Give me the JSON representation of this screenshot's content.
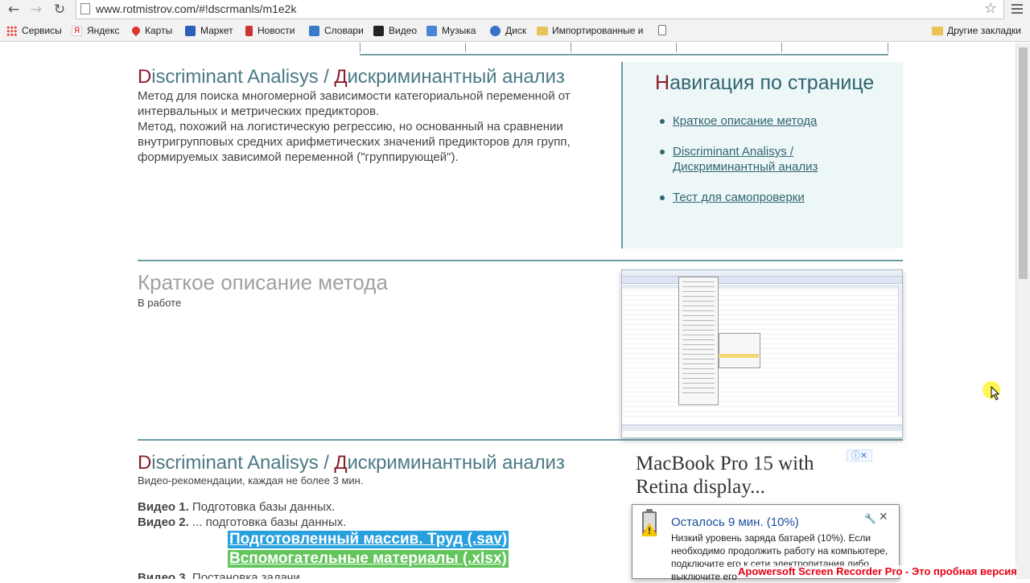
{
  "browser": {
    "url": "www.rotmistrov.com/#!dscrmanls/m1e2k",
    "bookmarks": [
      {
        "label": "Сервисы",
        "icon": "apps-icon"
      },
      {
        "label": "Яндекс",
        "icon": "yandex-icon"
      },
      {
        "label": "Карты",
        "icon": "maps-pin-icon"
      },
      {
        "label": "Маркет",
        "icon": "cart-icon"
      },
      {
        "label": "Новости",
        "icon": "news-icon"
      },
      {
        "label": "Словари",
        "icon": "dictionary-icon"
      },
      {
        "label": "Видео",
        "icon": "video-icon"
      },
      {
        "label": "Музыка",
        "icon": "music-icon"
      },
      {
        "label": "Диск",
        "icon": "disk-icon"
      },
      {
        "label": "Импортированные и",
        "icon": "folder-icon"
      }
    ],
    "other_bookmarks": "Другие закладки"
  },
  "section1": {
    "title_first": "D",
    "title_rest": "iscriminant Analisys / ",
    "title_first2": "Д",
    "title_rest2": "искриминантный анализ",
    "p1": "Метод для поиска многомерной зависимости категориальной переменной от интервальных и метрических предикторов.",
    "p2": "Метод, похожий на логистическую регрессию, но основанный на сравнении внутригрупповых средних арифметических значений предикторов для групп, формируемых зависимой переменной (\"группирующей\")."
  },
  "nav_box": {
    "title_first": "Н",
    "title_rest": "авигация по странице",
    "links": [
      "Краткое описание метода",
      "Discriminant Analisys / Дискриминантный анализ",
      "Тест для самопроверки"
    ]
  },
  "section2": {
    "title": "Краткое описание метода",
    "subtitle": "В работе"
  },
  "section3": {
    "title_first": "D",
    "title_rest": "iscriminant Analisys / ",
    "title_first2": "Д",
    "title_rest2": "искриминантный анализ",
    "subtitle": "Видео-рекомендации, каждая не более 3 мин.",
    "videos": [
      {
        "label": "Видео 1.",
        "text": " Подготовка базы данных."
      },
      {
        "label": "Видео 2.",
        "text": " ... подготовка базы данных."
      },
      {
        "label": "Видео 3.",
        "text": " Постановка задачи"
      }
    ],
    "download_sav": "Подготовленный массив. Труд (.sav)",
    "download_xlsx": "Вспомогательные материалы (.xlsx)"
  },
  "ad": {
    "title_line1": "MacBook Pro 15 with",
    "title_line2": "Retina display...",
    "badge": "ⓘ✕"
  },
  "battery_popup": {
    "title": "Осталось 9 мин. (10%)",
    "text": "Низкий уровень заряда батарей (10%). Если необходимо продолжить работу на компьютере, подключите его к сети электропитания либо выключите его"
  },
  "watermark": "Apowersoft Screen Recorder Pro - Это пробная версия",
  "colors": {
    "accent": "#4b7a85",
    "brand_red": "#8a1c2b",
    "download_blue": "#28a0dd",
    "download_green": "#62c65c",
    "watermark_red": "#e60012"
  }
}
